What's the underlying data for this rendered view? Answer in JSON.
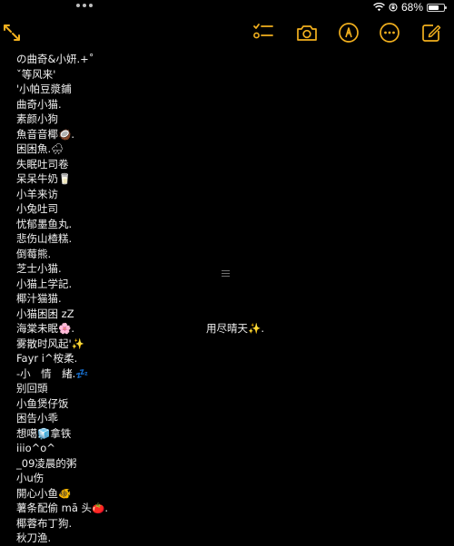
{
  "status_bar": {
    "battery_percent_label": "68%",
    "battery_level": 0.68,
    "icons": [
      "wifi-icon",
      "rotation-lock-icon",
      "battery-icon"
    ]
  },
  "toolbar": {
    "icons": [
      "collapse-expand-icon",
      "checklist-icon",
      "camera-icon",
      "markup-pen-icon",
      "more-icon",
      "compose-icon"
    ],
    "accent_color": "#F2B01E"
  },
  "note": {
    "lines": [
      "の曲奇&小妍.+˚",
      "ˇ等风来'",
      "'小帕豆漿鋪",
      "曲奇小猫.",
      "素颜小狗",
      "魚音音椰🥥.",
      "困困魚.🌧",
      "失眠吐司卷",
      "呆呆牛奶🥛",
      "小羊来访",
      "小兔吐司",
      "忧郁墨鱼丸.",
      "悲伤山楂糕.",
      "倒莓熊.",
      "芝士小猫.",
      "小猫上学記.",
      "椰汁猫猫.",
      "小猫困困 zZ",
      "海棠未眠🌸.",
      "雾散时风起'✨",
      "Fayr i^桉柔.",
      "-小　情　緒.💤",
      "别回頭",
      "小鱼煲仔饭",
      "困告小乖",
      "想噶🧊拿铁",
      "iiio^o^",
      "_09凌晨的粥",
      "小u伤",
      "開心小鱼🐠",
      "薯条配偷 mā 头🍅.",
      "椰蓉布丁狗.",
      "秋刀渔."
    ],
    "side_text": "用尽晴天✨."
  }
}
